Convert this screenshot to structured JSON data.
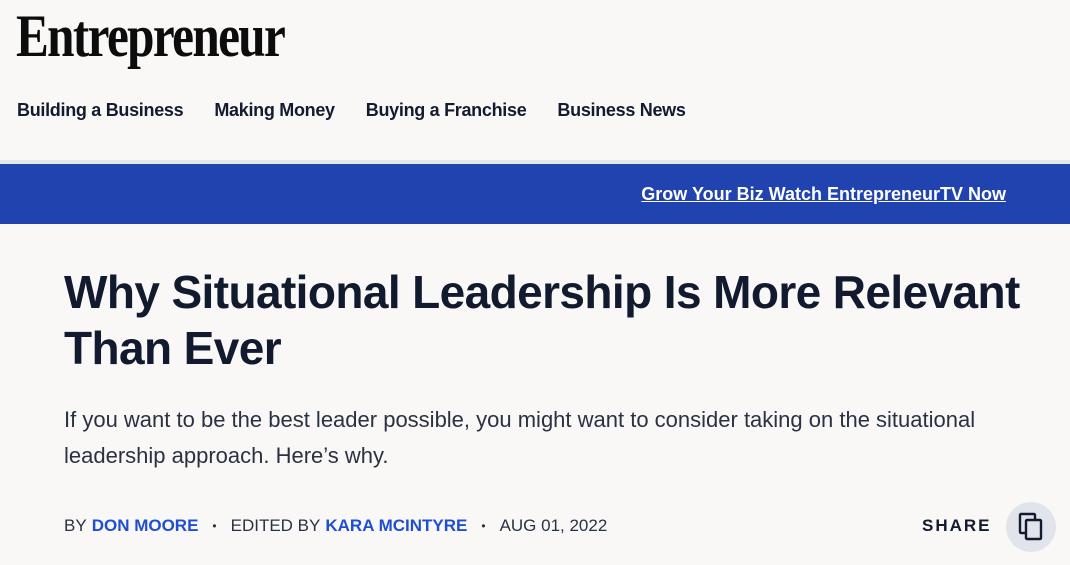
{
  "brand": {
    "logo_text": "Entrepreneur"
  },
  "nav": {
    "items": [
      {
        "label": "Building a Business"
      },
      {
        "label": "Making Money"
      },
      {
        "label": "Buying a Franchise"
      },
      {
        "label": "Business News"
      }
    ]
  },
  "promo": {
    "link_text": "Grow Your Biz Watch EntrepreneurTV Now",
    "background": "#2043b0"
  },
  "article": {
    "title": "Why Situational Leadership Is More Relevant Than Ever",
    "dek": "If you want to be the best leader possible, you might want to consider taking on the situational leadership approach. Here’s why.",
    "byline": {
      "by_prefix": "BY",
      "author": "DON MOORE",
      "separator": "•",
      "edited_prefix": "EDITED BY",
      "editor": "KARA MCINTYRE",
      "date": "AUG 01, 2022"
    }
  },
  "share": {
    "label": "SHARE",
    "icon": "copy-icon"
  },
  "colors": {
    "link_blue": "#1f4fd1",
    "text_dark": "#141b2e",
    "page_bg": "#f9f8f6"
  }
}
